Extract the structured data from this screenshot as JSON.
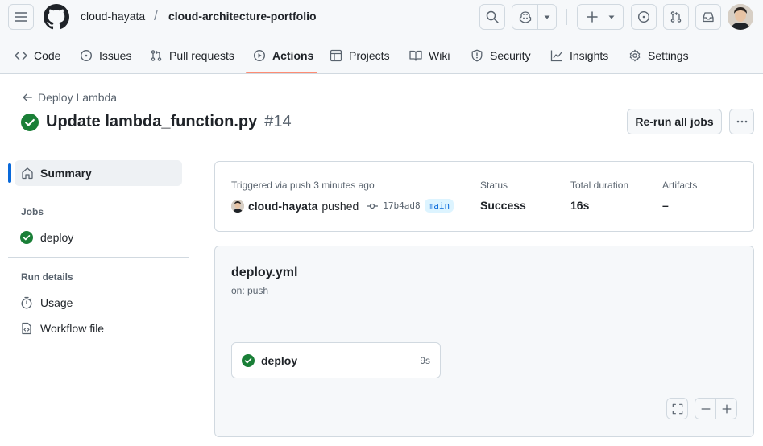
{
  "header": {
    "owner": "cloud-hayata",
    "separator": "/",
    "repo": "cloud-architecture-portfolio"
  },
  "nav": {
    "tabs": [
      {
        "label": "Code",
        "icon": "code-icon"
      },
      {
        "label": "Issues",
        "icon": "issue-opened-icon"
      },
      {
        "label": "Pull requests",
        "icon": "git-pull-request-icon"
      },
      {
        "label": "Actions",
        "icon": "play-icon",
        "active": true
      },
      {
        "label": "Projects",
        "icon": "table-icon"
      },
      {
        "label": "Wiki",
        "icon": "book-icon"
      },
      {
        "label": "Security",
        "icon": "shield-icon"
      },
      {
        "label": "Insights",
        "icon": "graph-icon"
      },
      {
        "label": "Settings",
        "icon": "gear-icon"
      }
    ]
  },
  "run": {
    "back_label": "Deploy Lambda",
    "title": "Update lambda_function.py",
    "number": "#14",
    "rerun_label": "Re-run all jobs"
  },
  "sidebar": {
    "summary_label": "Summary",
    "jobs_heading": "Jobs",
    "job_label": "deploy",
    "run_details_heading": "Run details",
    "usage_label": "Usage",
    "workflow_file_label": "Workflow file"
  },
  "summary": {
    "trigger_label": "Triggered via push 3 minutes ago",
    "actor": "cloud-hayata",
    "action": "pushed",
    "sha": "17b4ad8",
    "branch": "main",
    "status_label": "Status",
    "status_value": "Success",
    "duration_label": "Total duration",
    "duration_value": "16s",
    "artifacts_label": "Artifacts",
    "artifacts_value": "–"
  },
  "workflow": {
    "file": "deploy.yml",
    "trigger": "on: push",
    "job_name": "deploy",
    "job_duration": "9s"
  },
  "colors": {
    "success": "#1a7f37",
    "accent_underline": "#fd8c73",
    "link_blue": "#0969da"
  }
}
